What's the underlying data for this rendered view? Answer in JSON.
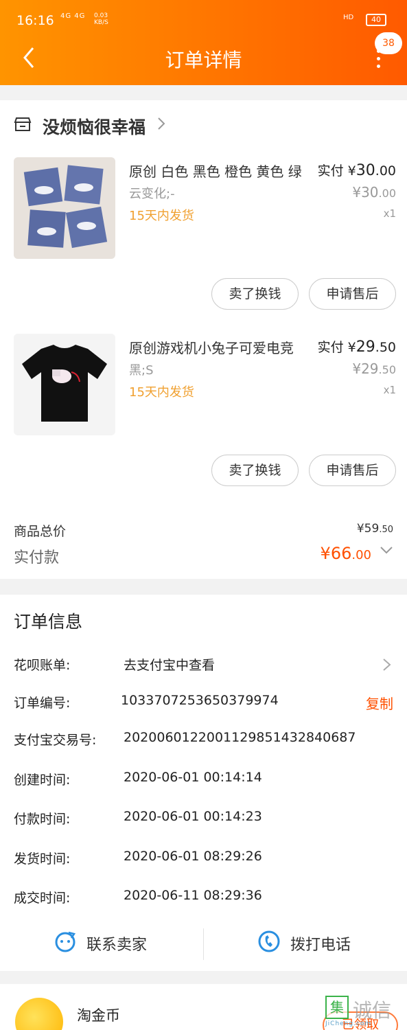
{
  "status_bar": {
    "time": "16:16",
    "network": "4G 4G",
    "speed": "0.03\nKB/S",
    "hd": "HD",
    "battery": "40"
  },
  "nav": {
    "title": "订单详情",
    "badge": "38"
  },
  "shop": {
    "name": "没烦恼很幸福"
  },
  "items": [
    {
      "title": "原创 白色 黑色 橙色 黄色 绿",
      "sku": "云变化;-",
      "ship": "15天内发货",
      "paid_prefix": "实付 ¥",
      "paid_int": "30",
      "paid_dec": ".00",
      "orig_int": "¥30",
      "orig_dec": ".00",
      "qty": "x1",
      "sell": "卖了换钱",
      "after": "申请售后"
    },
    {
      "title": "原创游戏机小兔子可爱电竞",
      "sku": "黑;S",
      "ship": "15天内发货",
      "paid_prefix": "实付 ¥",
      "paid_int": "29",
      "paid_dec": ".50",
      "orig_int": "¥29",
      "orig_dec": ".50",
      "qty": "x1",
      "sell": "卖了换钱",
      "after": "申请售后"
    }
  ],
  "totals": {
    "goods_label": "商品总价",
    "goods_int": "¥59",
    "goods_dec": ".50",
    "paid_label": "实付款",
    "paid_int": "¥66",
    "paid_dec": ".00"
  },
  "order_info": {
    "title": "订单信息",
    "rows": [
      {
        "k": "花呗账单:",
        "v": "去支付宝中查看"
      },
      {
        "k": "订单编号:",
        "v": "1033707253650379974"
      },
      {
        "k": "支付宝交易号:",
        "v": "2020060122001129851432840687"
      },
      {
        "k": "创建时间:",
        "v": "2020-06-01 00:14:14"
      },
      {
        "k": "付款时间:",
        "v": "2020-06-01 00:14:23"
      },
      {
        "k": "发货时间:",
        "v": "2020-06-01 08:29:26"
      },
      {
        "k": "成交时间:",
        "v": "2020-06-11 08:29:36"
      }
    ],
    "copy_label": "复制",
    "contact_seller": "联系卖家",
    "call_phone": "拨打电话"
  },
  "coins": {
    "label": "淘金币",
    "claim": "已领取"
  },
  "watermark": {
    "box": "集",
    "text": "诚信",
    "sub": "JiCheng.com"
  },
  "colors": {
    "header_start": "#ff9400",
    "header_end": "#ff5a00",
    "accent": "#ff5000",
    "ship": "#f0a030"
  }
}
